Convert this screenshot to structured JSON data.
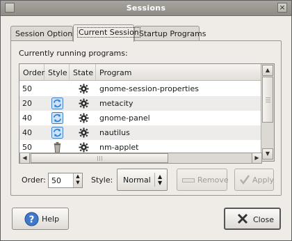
{
  "window": {
    "title": "Sessions"
  },
  "tabs": [
    {
      "label": "Session Options"
    },
    {
      "label": "Current Session"
    },
    {
      "label": "Startup Programs"
    }
  ],
  "current_session": {
    "caption": "Currently running programs:",
    "columns": [
      "Order",
      "Style",
      "State",
      "Program"
    ],
    "rows": [
      {
        "order": "50",
        "style": "",
        "state": "gear-icon",
        "program": "gnome-session-properties"
      },
      {
        "order": "20",
        "style": "restart-icon",
        "state": "gear-icon",
        "program": "metacity"
      },
      {
        "order": "40",
        "style": "restart-icon",
        "state": "gear-icon",
        "program": "gnome-panel"
      },
      {
        "order": "40",
        "style": "restart-icon",
        "state": "gear-icon",
        "program": "nautilus"
      },
      {
        "order": "50",
        "style": "trash-icon",
        "state": "gear-icon",
        "program": "nm-applet"
      }
    ],
    "order_label": "Order:",
    "order_value": "50",
    "style_label": "Style:",
    "style_value": "Normal",
    "remove_label": "Remove",
    "apply_label": "Apply"
  },
  "footer": {
    "help_label": "Help",
    "close_label": "Close"
  },
  "colors": {
    "titlebar": "#9b9792",
    "window_bg": "#efebe7",
    "row_alt": "#edeceb",
    "restart_icon": "#2f7fd0"
  }
}
